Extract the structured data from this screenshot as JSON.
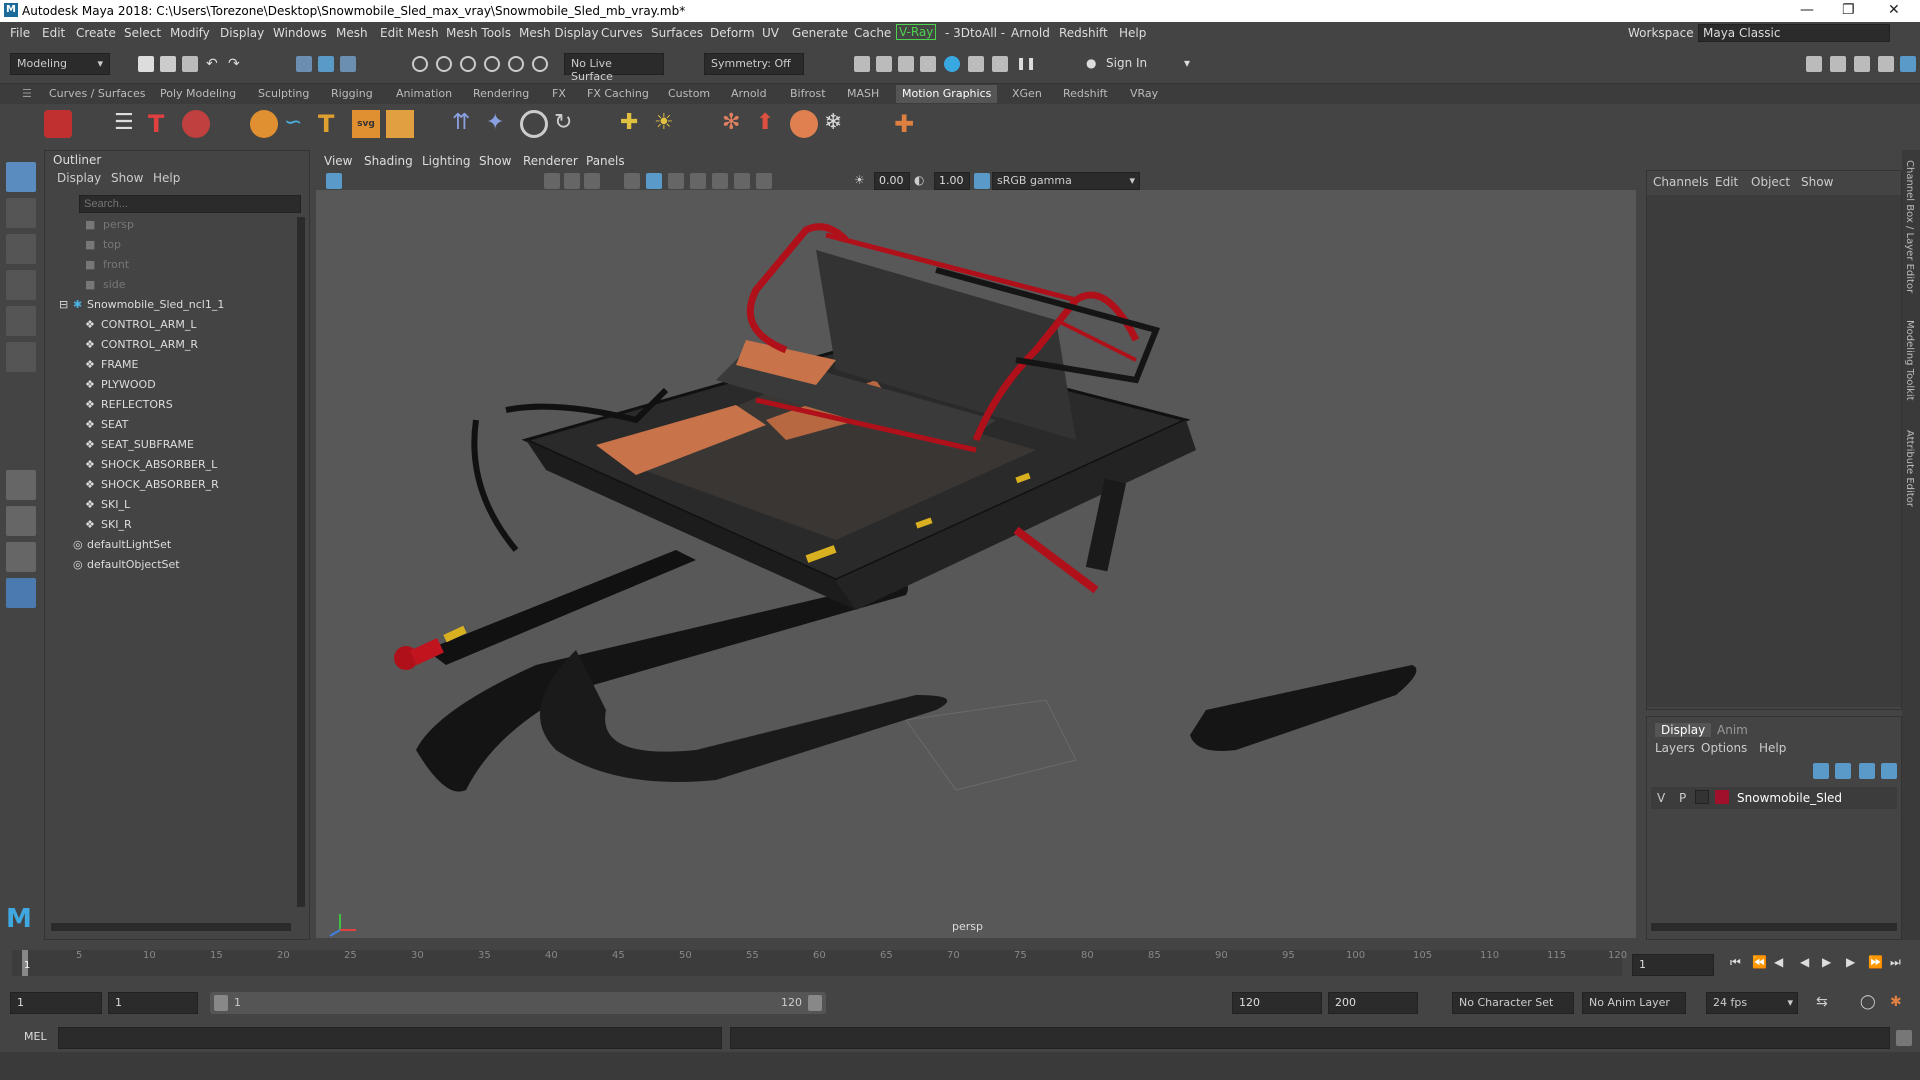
{
  "window": {
    "title": "Autodesk Maya 2018: C:\\Users\\Torezone\\Desktop\\Snowmobile_Sled_max_vray\\Snowmobile_Sled_mb_vray.mb*"
  },
  "menubar": {
    "items": [
      "File",
      "Edit",
      "Create",
      "Select",
      "Modify",
      "Display",
      "Windows",
      "Mesh",
      "Edit Mesh",
      "Mesh Tools",
      "Mesh Display",
      "Curves",
      "Surfaces",
      "Deform",
      "UV",
      "Generate",
      "Cache",
      "V-Ray",
      "- 3DtoAll -",
      "Arnold",
      "Redshift",
      "Help"
    ],
    "workspace_label": "Workspace :",
    "workspace_value": "Maya Classic"
  },
  "statusline": {
    "mode": "Modeling",
    "live_surface": "No Live Surface",
    "symmetry": "Symmetry: Off",
    "sign_in": "Sign In"
  },
  "shelf": {
    "tabs": [
      "Curves / Surfaces",
      "Poly Modeling",
      "Sculpting",
      "Rigging",
      "Animation",
      "Rendering",
      "FX",
      "FX Caching",
      "Custom",
      "Arnold",
      "Bifrost",
      "MASH",
      "Motion Graphics",
      "XGen",
      "Redshift",
      "VRay"
    ],
    "active_tab": "Motion Graphics"
  },
  "outliner": {
    "title": "Outliner",
    "menu": [
      "Display",
      "Show",
      "Help"
    ],
    "search_placeholder": "Search...",
    "cameras": [
      "persp",
      "top",
      "front",
      "side"
    ],
    "group": "Snowmobile_Sled_ncl1_1",
    "children": [
      "CONTROL_ARM_L",
      "CONTROL_ARM_R",
      "FRAME",
      "PLYWOOD",
      "REFLECTORS",
      "SEAT",
      "SEAT_SUBFRAME",
      "SHOCK_ABSORBER_L",
      "SHOCK_ABSORBER_R",
      "SKI_L",
      "SKI_R"
    ],
    "sets": [
      "defaultLightSet",
      "defaultObjectSet"
    ]
  },
  "viewport": {
    "menu": [
      "View",
      "Shading",
      "Lighting",
      "Show",
      "Renderer",
      "Panels"
    ],
    "exposure": "0.00",
    "gamma": "1.00",
    "color_space": "sRGB gamma",
    "camera_label": "persp"
  },
  "channelbox": {
    "menu": [
      "Channels",
      "Edit",
      "Object",
      "Show"
    ]
  },
  "layers": {
    "tabs": [
      "Display",
      "Anim"
    ],
    "menu": [
      "Layers",
      "Options",
      "Help"
    ],
    "layer": {
      "v": "V",
      "p": "P",
      "name": "Snowmobile_Sled",
      "color": "#a0102a"
    }
  },
  "sidetabs": [
    "Channel Box / Layer Editor",
    "Modeling Toolkit",
    "Attribute Editor"
  ],
  "timeline": {
    "ticks": [
      "5",
      "10",
      "15",
      "20",
      "25",
      "30",
      "35",
      "40",
      "45",
      "50",
      "55",
      "60",
      "65",
      "70",
      "75",
      "80",
      "85",
      "90",
      "95",
      "100",
      "105",
      "110",
      "115",
      "120"
    ],
    "start_marker": "1",
    "current_frame": "1"
  },
  "range": {
    "start": "1",
    "start_inner": "1",
    "slider_start": "1",
    "slider_end": "120",
    "end_inner": "120",
    "end": "200",
    "character_set": "No Character Set",
    "anim_layer": "No Anim Layer",
    "fps": "24 fps"
  },
  "cmdline": {
    "label": "MEL"
  },
  "colors": {
    "sled_red": "#b0101a",
    "plywood": "#c8734a",
    "vray_green": "#4cd24c"
  }
}
